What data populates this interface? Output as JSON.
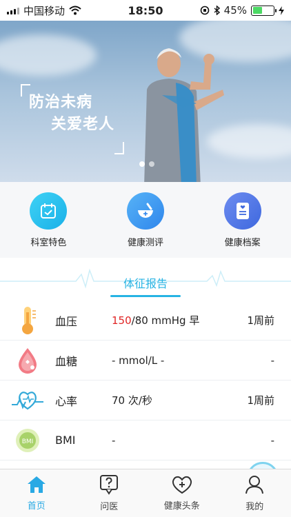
{
  "status_bar": {
    "carrier": "中国移动",
    "time": "18:50",
    "battery": "45%",
    "battery_level": 0.45
  },
  "banner": {
    "line1": "防治未病",
    "line2": "关爱老人",
    "slides_count": 2,
    "active_slide": 1
  },
  "quick_menu": [
    {
      "label": "科室特色",
      "icon": "calendar-check-icon",
      "color": "#29c4ef"
    },
    {
      "label": "健康测评",
      "icon": "mortar-pestle-icon",
      "color": "#3a9cf0"
    },
    {
      "label": "健康档案",
      "icon": "document-heart-icon",
      "color": "#4c7ee8"
    }
  ],
  "report": {
    "title": "体征报告"
  },
  "vitals": [
    {
      "name": "血压",
      "value_highlight": "150",
      "value_rest": "/80 mmHg 早",
      "time": "1周前",
      "icon": "thermometer-icon"
    },
    {
      "name": "血糖",
      "value_highlight": "",
      "value_rest": "- mmol/L -",
      "time": "-",
      "icon": "blood-drop-icon"
    },
    {
      "name": "心率",
      "value_highlight": "",
      "value_rest": "70 次/秒",
      "time": "1周前",
      "icon": "heart-pulse-icon"
    },
    {
      "name": "BMI",
      "value_highlight": "",
      "value_rest": "-",
      "time": "-",
      "icon": "bmi-icon",
      "icon_text": "BMI"
    }
  ],
  "tabbar": [
    {
      "label": "首页",
      "icon": "home-icon",
      "active": true
    },
    {
      "label": "问医",
      "icon": "question-bubble-icon",
      "active": false
    },
    {
      "label": "健康头条",
      "icon": "heart-plus-icon",
      "active": false
    },
    {
      "label": "我的",
      "icon": "user-icon",
      "active": false
    }
  ],
  "colors": {
    "accent": "#26b3e3",
    "highlight_red": "#e02424"
  }
}
